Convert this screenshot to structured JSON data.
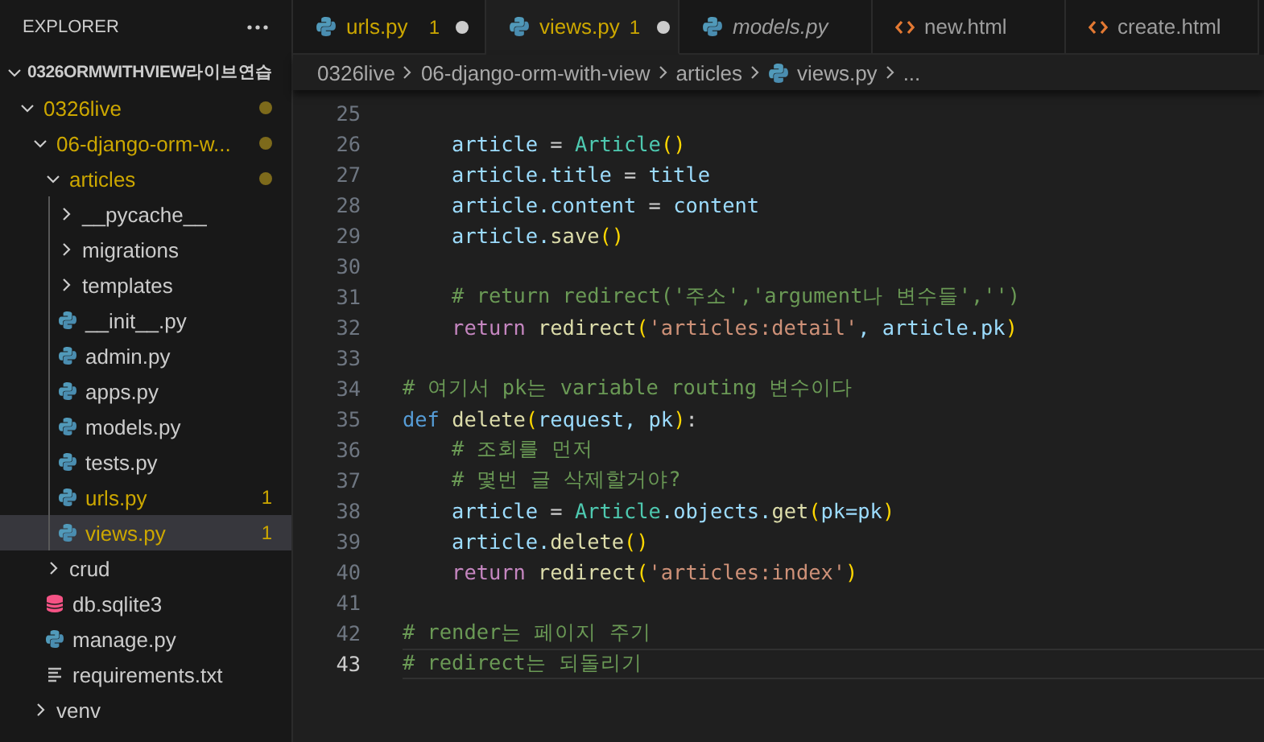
{
  "explorer": {
    "title": "EXPLORER",
    "tree": [
      {
        "name": "0326ORMWITHVIEW라이브연습",
        "kind": "folder",
        "expanded": true,
        "selected": false,
        "children": [
          {
            "name": "0326live",
            "kind": "folder",
            "expanded": true,
            "modified": true,
            "selected": false,
            "children": [
              {
                "name": "06-django-orm-w...",
                "kind": "folder",
                "expanded": true,
                "modified": true,
                "selected": false,
                "children": [
                  {
                    "name": "articles",
                    "kind": "folder",
                    "expanded": true,
                    "modified": true,
                    "selected": false,
                    "children": [
                      {
                        "name": "__pycache__",
                        "kind": "folder",
                        "expanded": false,
                        "modified": false,
                        "selected": false
                      },
                      {
                        "name": "migrations",
                        "kind": "folder",
                        "expanded": false,
                        "modified": false,
                        "selected": false
                      },
                      {
                        "name": "templates",
                        "kind": "folder",
                        "expanded": false,
                        "modified": false,
                        "selected": false
                      },
                      {
                        "name": "__init__.py",
                        "kind": "python",
                        "modified": false,
                        "selected": false
                      },
                      {
                        "name": "admin.py",
                        "kind": "python",
                        "modified": false,
                        "selected": false
                      },
                      {
                        "name": "apps.py",
                        "kind": "python",
                        "modified": false,
                        "selected": false
                      },
                      {
                        "name": "models.py",
                        "kind": "python",
                        "modified": false,
                        "selected": false
                      },
                      {
                        "name": "tests.py",
                        "kind": "python",
                        "modified": false,
                        "selected": false
                      },
                      {
                        "name": "urls.py",
                        "kind": "python",
                        "modified": true,
                        "badge": "1",
                        "selected": false
                      },
                      {
                        "name": "views.py",
                        "kind": "python",
                        "modified": true,
                        "badge": "1",
                        "selected": true
                      }
                    ]
                  },
                  {
                    "name": "crud",
                    "kind": "folder",
                    "expanded": false,
                    "modified": false,
                    "selected": false
                  },
                  {
                    "name": "db.sqlite3",
                    "kind": "database",
                    "modified": false,
                    "selected": false
                  },
                  {
                    "name": "manage.py",
                    "kind": "python",
                    "modified": false,
                    "selected": false
                  },
                  {
                    "name": "requirements.txt",
                    "kind": "text",
                    "modified": false,
                    "selected": false
                  }
                ]
              },
              {
                "name": "venv",
                "kind": "folder",
                "expanded": false,
                "modified": false,
                "selected": false
              }
            ]
          }
        ]
      }
    ]
  },
  "tabs": [
    {
      "label": "urls.py",
      "kind": "python",
      "selected": false,
      "preview": false,
      "badge": "1",
      "unsaved": true
    },
    {
      "label": "views.py",
      "kind": "python",
      "selected": true,
      "preview": false,
      "badge": "1",
      "unsaved": true
    },
    {
      "label": "models.py",
      "kind": "python",
      "selected": false,
      "preview": true,
      "unsaved": false
    },
    {
      "label": "new.html",
      "kind": "html",
      "selected": false,
      "preview": false,
      "unsaved": false
    },
    {
      "label": "create.html",
      "kind": "html",
      "selected": false,
      "preview": false,
      "unsaved": false
    }
  ],
  "breadcrumb": [
    {
      "label": "0326live",
      "kind": "folder"
    },
    {
      "label": "06-django-orm-with-view",
      "kind": "folder"
    },
    {
      "label": "articles",
      "kind": "folder"
    },
    {
      "label": "views.py",
      "kind": "python"
    },
    {
      "label": "...",
      "kind": "more"
    }
  ],
  "editor": {
    "lines": [
      {
        "number": "25",
        "current": false
      },
      {
        "number": "26",
        "current": false,
        "tokens": [
          {
            "kind": "var",
            "t": "    article"
          },
          {
            "kind": "op",
            "t": " = "
          },
          {
            "kind": "cls",
            "t": "Article"
          },
          {
            "kind": "par",
            "t": "()"
          }
        ]
      },
      {
        "number": "27",
        "current": false,
        "tokens": [
          {
            "kind": "var",
            "t": "    article.title"
          },
          {
            "kind": "op",
            "t": " = "
          },
          {
            "kind": "var",
            "t": "title"
          }
        ]
      },
      {
        "number": "28",
        "current": false,
        "tokens": [
          {
            "kind": "var",
            "t": "    article.content"
          },
          {
            "kind": "op",
            "t": " = "
          },
          {
            "kind": "var",
            "t": "content"
          }
        ]
      },
      {
        "number": "29",
        "current": false,
        "tokens": [
          {
            "kind": "var",
            "t": "    article."
          },
          {
            "kind": "fn",
            "t": "save"
          },
          {
            "kind": "par",
            "t": "()"
          }
        ]
      },
      {
        "number": "30",
        "current": false
      },
      {
        "number": "31",
        "current": false,
        "tokens": [
          {
            "kind": "cmt",
            "t": "    # return redirect('주소','argument나 변수들','')"
          }
        ]
      },
      {
        "number": "32",
        "current": false,
        "tokens": [
          {
            "kind": "kw",
            "t": "    return "
          },
          {
            "kind": "fn",
            "t": "redirect"
          },
          {
            "kind": "par",
            "t": "("
          },
          {
            "kind": "str",
            "t": "'articles:detail'"
          },
          {
            "kind": "var",
            "t": ", article.pk"
          },
          {
            "kind": "par",
            "t": ")"
          }
        ]
      },
      {
        "number": "33",
        "current": false
      },
      {
        "number": "34",
        "current": false,
        "tokens": [
          {
            "kind": "cmt",
            "t": "# 여기서 pk는 variable routing 변수이다"
          }
        ]
      },
      {
        "number": "35",
        "current": false,
        "tokens": [
          {
            "kind": "def",
            "t": "def "
          },
          {
            "kind": "fn",
            "t": "delete"
          },
          {
            "kind": "par",
            "t": "("
          },
          {
            "kind": "var",
            "t": "request, pk"
          },
          {
            "kind": "par",
            "t": ")"
          },
          {
            "kind": "op",
            "t": ":"
          }
        ]
      },
      {
        "number": "36",
        "current": false,
        "tokens": [
          {
            "kind": "cmt",
            "t": "    # 조회를 먼저"
          }
        ]
      },
      {
        "number": "37",
        "current": false,
        "tokens": [
          {
            "kind": "cmt",
            "t": "    # 몇번 글 삭제할거야?"
          }
        ]
      },
      {
        "number": "38",
        "current": false,
        "tokens": [
          {
            "kind": "var",
            "t": "    article"
          },
          {
            "kind": "op",
            "t": " = "
          },
          {
            "kind": "cls",
            "t": "Article"
          },
          {
            "kind": "var",
            "t": ".objects."
          },
          {
            "kind": "fn",
            "t": "get"
          },
          {
            "kind": "par",
            "t": "("
          },
          {
            "kind": "var",
            "t": "pk=pk"
          },
          {
            "kind": "par",
            "t": ")"
          }
        ]
      },
      {
        "number": "39",
        "current": false,
        "tokens": [
          {
            "kind": "var",
            "t": "    article."
          },
          {
            "kind": "fn",
            "t": "delete"
          },
          {
            "kind": "par",
            "t": "()"
          }
        ]
      },
      {
        "number": "40",
        "current": false,
        "tokens": [
          {
            "kind": "kw",
            "t": "    return "
          },
          {
            "kind": "fn",
            "t": "redirect"
          },
          {
            "kind": "par",
            "t": "("
          },
          {
            "kind": "str",
            "t": "'articles:index'"
          },
          {
            "kind": "par",
            "t": ")"
          }
        ]
      },
      {
        "number": "41",
        "current": false
      },
      {
        "number": "42",
        "current": false,
        "tokens": [
          {
            "kind": "cmt",
            "t": "# render는 페이지 주기"
          }
        ]
      },
      {
        "number": "43",
        "current": true,
        "tokens": [
          {
            "kind": "cmt",
            "t": "# redirect는 되돌리기"
          }
        ]
      }
    ]
  }
}
